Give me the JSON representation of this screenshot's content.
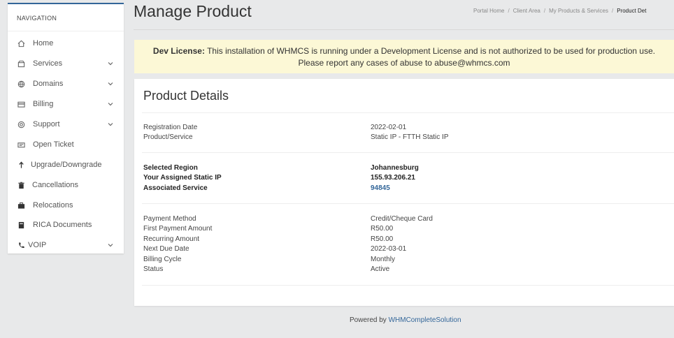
{
  "sidebar": {
    "heading": "NAVIGATION",
    "items": [
      {
        "label": "Home",
        "icon": "home-icon",
        "has_children": false
      },
      {
        "label": "Services",
        "icon": "box-icon",
        "has_children": true
      },
      {
        "label": "Domains",
        "icon": "globe-icon",
        "has_children": true
      },
      {
        "label": "Billing",
        "icon": "credit-card-icon",
        "has_children": true
      },
      {
        "label": "Support",
        "icon": "lifebuoy-icon",
        "has_children": true
      },
      {
        "label": "Open Ticket",
        "icon": "ticket-icon",
        "has_children": false
      },
      {
        "label": "Upgrade/Downgrade",
        "icon": "arrow-up-icon",
        "has_children": false
      },
      {
        "label": "Cancellations",
        "icon": "trash-icon",
        "has_children": false
      },
      {
        "label": "Relocations",
        "icon": "briefcase-icon",
        "has_children": false
      },
      {
        "label": "RICA Documents",
        "icon": "book-icon",
        "has_children": false
      },
      {
        "label": "VOIP",
        "icon": "phone-icon",
        "has_children": true
      }
    ]
  },
  "header": {
    "title": "Manage Product",
    "breadcrumb": [
      "Portal Home",
      "Client Area",
      "My Products & Services",
      "Product Det"
    ]
  },
  "alert": {
    "strong": "Dev License:",
    "line1": " This installation of WHMCS is running under a Development License and is not authorized to be used for production use.",
    "line2": "Please report any cases of abuse to abuse@whmcs.com"
  },
  "product": {
    "title": "Product Details",
    "group1": [
      {
        "label": "Registration Date",
        "value": "2022-02-01"
      },
      {
        "label": "Product/Service",
        "value": "Static IP - FTTH Static IP"
      }
    ],
    "group2": [
      {
        "label": "Selected Region",
        "value": "Johannesburg"
      },
      {
        "label": "Your Assigned Static IP",
        "value": "155.93.206.21"
      },
      {
        "label": "Associated Service",
        "value": "94845"
      }
    ],
    "group3": [
      {
        "label": "Payment Method",
        "value": "Credit/Cheque Card"
      },
      {
        "label": "First Payment Amount",
        "value": "R50.00"
      },
      {
        "label": "Recurring Amount",
        "value": "R50.00"
      },
      {
        "label": "Next Due Date",
        "value": "2022-03-01"
      },
      {
        "label": "Billing Cycle",
        "value": "Monthly"
      },
      {
        "label": "Status",
        "value": "Active"
      }
    ]
  },
  "footer": {
    "prefix": "Powered by ",
    "link": "WHMCompleteSolution"
  },
  "colors": {
    "accent": "#336699",
    "alert_bg": "#fcf8d6",
    "page_bg": "#e8e9ea"
  }
}
